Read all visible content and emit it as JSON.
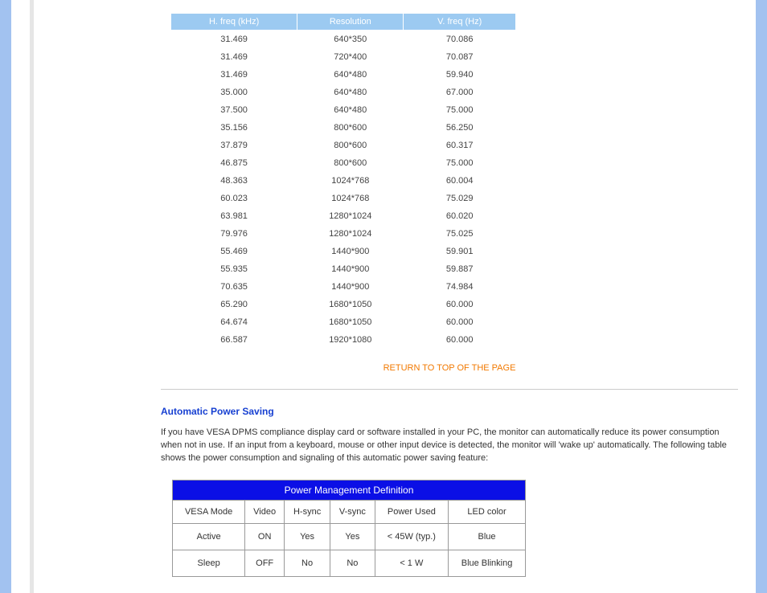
{
  "timing": {
    "headers": [
      "H. freq (kHz)",
      "Resolution",
      "V. freq (Hz)"
    ],
    "rows": [
      [
        "31.469",
        "640*350",
        "70.086"
      ],
      [
        "31.469",
        "720*400",
        "70.087"
      ],
      [
        "31.469",
        "640*480",
        "59.940"
      ],
      [
        "35.000",
        "640*480",
        "67.000"
      ],
      [
        "37.500",
        "640*480",
        "75.000"
      ],
      [
        "35.156",
        "800*600",
        "56.250"
      ],
      [
        "37.879",
        "800*600",
        "60.317"
      ],
      [
        "46.875",
        "800*600",
        "75.000"
      ],
      [
        "48.363",
        "1024*768",
        "60.004"
      ],
      [
        "60.023",
        "1024*768",
        "75.029"
      ],
      [
        "63.981",
        "1280*1024",
        "60.020"
      ],
      [
        "79.976",
        "1280*1024",
        "75.025"
      ],
      [
        "55.469",
        "1440*900",
        "59.901"
      ],
      [
        "55.935",
        "1440*900",
        "59.887"
      ],
      [
        "70.635",
        "1440*900",
        "74.984"
      ],
      [
        "65.290",
        "1680*1050",
        "60.000"
      ],
      [
        "64.674",
        "1680*1050",
        "60.000"
      ],
      [
        "66.587",
        "1920*1080",
        "60.000"
      ]
    ]
  },
  "return_link": "RETURN TO TOP OF THE PAGE",
  "power_section": {
    "heading": "Automatic Power Saving",
    "body": "If you have VESA DPMS compliance display card or software installed in your PC, the monitor can automatically reduce its power consumption when not in use. If an input from a keyboard, mouse or other input device is detected, the monitor will 'wake up' automatically. The following table shows the power consumption and signaling of this automatic power saving feature:"
  },
  "power_table": {
    "title": "Power Management Definition",
    "headers": [
      "VESA Mode",
      "Video",
      "H-sync",
      "V-sync",
      "Power Used",
      "LED color"
    ],
    "rows": [
      [
        "Active",
        "ON",
        "Yes",
        "Yes",
        "< 45W (typ.)",
        "Blue"
      ],
      [
        "Sleep",
        "OFF",
        "No",
        "No",
        "< 1 W",
        "Blue Blinking"
      ]
    ]
  },
  "chart_data": [
    {
      "type": "table",
      "title": "Timing Modes",
      "columns": [
        "H. freq (kHz)",
        "Resolution",
        "V. freq (Hz)"
      ],
      "rows": [
        [
          31.469,
          "640*350",
          70.086
        ],
        [
          31.469,
          "720*400",
          70.087
        ],
        [
          31.469,
          "640*480",
          59.94
        ],
        [
          35.0,
          "640*480",
          67.0
        ],
        [
          37.5,
          "640*480",
          75.0
        ],
        [
          35.156,
          "800*600",
          56.25
        ],
        [
          37.879,
          "800*600",
          60.317
        ],
        [
          46.875,
          "800*600",
          75.0
        ],
        [
          48.363,
          "1024*768",
          60.004
        ],
        [
          60.023,
          "1024*768",
          75.029
        ],
        [
          63.981,
          "1280*1024",
          60.02
        ],
        [
          79.976,
          "1280*1024",
          75.025
        ],
        [
          55.469,
          "1440*900",
          59.901
        ],
        [
          55.935,
          "1440*900",
          59.887
        ],
        [
          70.635,
          "1440*900",
          74.984
        ],
        [
          65.29,
          "1680*1050",
          60.0
        ],
        [
          64.674,
          "1680*1050",
          60.0
        ],
        [
          66.587,
          "1920*1080",
          60.0
        ]
      ]
    },
    {
      "type": "table",
      "title": "Power Management Definition",
      "columns": [
        "VESA Mode",
        "Video",
        "H-sync",
        "V-sync",
        "Power Used",
        "LED color"
      ],
      "rows": [
        [
          "Active",
          "ON",
          "Yes",
          "Yes",
          "< 45W (typ.)",
          "Blue"
        ],
        [
          "Sleep",
          "OFF",
          "No",
          "No",
          "< 1 W",
          "Blue Blinking"
        ]
      ]
    }
  ]
}
